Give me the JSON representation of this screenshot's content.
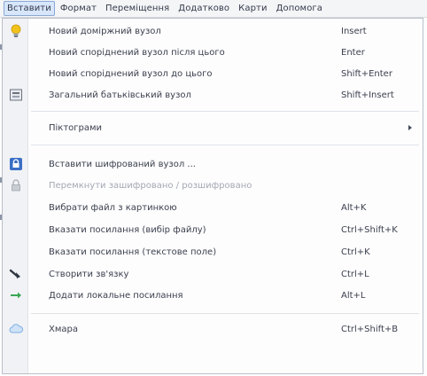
{
  "menubar": {
    "items": [
      {
        "label": "Вставити",
        "active": true
      },
      {
        "label": "Формат"
      },
      {
        "label": "Переміщення"
      },
      {
        "label": "Додатково"
      },
      {
        "label": "Карти"
      },
      {
        "label": "Допомога"
      }
    ]
  },
  "menu": {
    "items": [
      {
        "label": "Новий доміржний вузол",
        "shortcut": "Insert",
        "icon": "lightbulb-icon"
      },
      {
        "label": "Новий споріднений вузол після цього",
        "shortcut": "Enter"
      },
      {
        "label": "Новий споріднений вузол до цього",
        "shortcut": "Shift+Enter"
      },
      {
        "label": "Загальний батьківський вузол",
        "shortcut": "Shift+Insert",
        "icon": "parent-node-icon"
      },
      {
        "label": "Піктограми",
        "shortcut": ""
      },
      {
        "label": "Вставити шифрований вузол ...",
        "shortcut": "",
        "icon": "encrypted-node-icon"
      },
      {
        "label": "Перемкнути зашифровано / розшифровано",
        "shortcut": "",
        "icon": "lock-icon",
        "disabled": true
      },
      {
        "label": "Вибрати файл з картинкою",
        "shortcut": "Alt+K"
      },
      {
        "label": "Вказати посилання (вибір файлу)",
        "shortcut": "Ctrl+Shift+K"
      },
      {
        "label": "Вказати посилання (текстове поле)",
        "shortcut": "Ctrl+K"
      },
      {
        "label": "Створити зв'язку",
        "shortcut": "Ctrl+L",
        "icon": "link-arrow-icon"
      },
      {
        "label": "Додати локальне посилання",
        "shortcut": "Alt+L",
        "icon": "green-arrow-icon"
      },
      {
        "label": "Хмара",
        "shortcut": "Ctrl+Shift+B",
        "icon": "cloud-icon"
      }
    ]
  },
  "colors": {
    "accent": "#d7e6fa",
    "lightbulb": "#f2c21b",
    "encrypted": "#3b6fc6",
    "green_arrow": "#3aa655",
    "cloud": "#7fb0e6"
  }
}
